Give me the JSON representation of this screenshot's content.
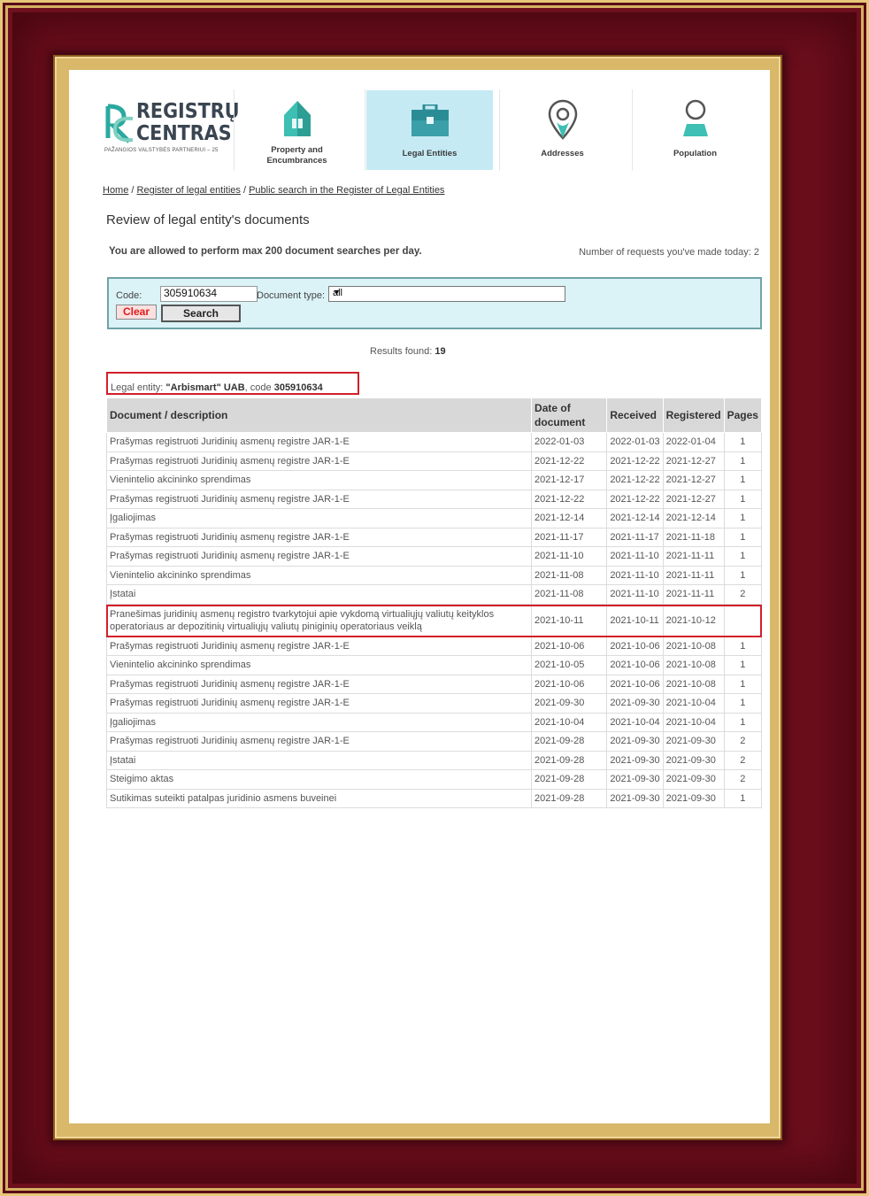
{
  "logo": {
    "line1": "REGISTRŲ",
    "line2": "CENTRAS",
    "tagline": "PAŽANGIOS VALSTYBĖS PARTNERIUI – 25"
  },
  "nav": [
    {
      "label_l1": "Property and",
      "label_l2": "Encumbrances",
      "icon": "house-icon",
      "active": false
    },
    {
      "label_l1": "Legal Entities",
      "label_l2": "",
      "icon": "briefcase-icon",
      "active": true
    },
    {
      "label_l1": "Addresses",
      "label_l2": "",
      "icon": "map-pin-icon",
      "active": false
    },
    {
      "label_l1": "Population",
      "label_l2": "",
      "icon": "person-icon",
      "active": false
    }
  ],
  "breadcrumb": {
    "home": "Home",
    "sep1": " / ",
    "register": "Register of legal entities",
    "sep2": " / ",
    "search": "Public search in the Register of Legal Entities"
  },
  "page_title": "Review of legal entity's documents",
  "limit_text": "You are allowed to perform max 200 document searches per day.",
  "requests_text": "Number of requests you've made today: 2",
  "search": {
    "code_label": "Code:",
    "code_value": "305910634",
    "doctype_label": "Document type:",
    "doctype_value": "all",
    "clear": "Clear",
    "search": "Search"
  },
  "results": {
    "label": "Results found:",
    "count": "19"
  },
  "entity": {
    "label": "Legal entity:",
    "name": "\"Arbismart\" UAB",
    "code_label": ", code",
    "code": "305910634"
  },
  "colors": {
    "accent": "#c6eaf4",
    "highlight": "#d21f2a",
    "frame": "#6e0f1e"
  },
  "table": {
    "headers": {
      "doc": "Document / description",
      "date": "Date of document",
      "received": "Received",
      "registered": "Registered",
      "pages": "Pages"
    },
    "rows": [
      {
        "doc": "Prašymas registruoti Juridinių asmenų registre JAR-1-E",
        "date": "2022-01-03",
        "received": "2022-01-03",
        "registered": "2022-01-04",
        "pages": "1"
      },
      {
        "doc": "Prašymas registruoti Juridinių asmenų registre JAR-1-E",
        "date": "2021-12-22",
        "received": "2021-12-22",
        "registered": "2021-12-27",
        "pages": "1"
      },
      {
        "doc": "Vienintelio akcininko sprendimas",
        "date": "2021-12-17",
        "received": "2021-12-22",
        "registered": "2021-12-27",
        "pages": "1"
      },
      {
        "doc": "Prašymas registruoti Juridinių asmenų registre JAR-1-E",
        "date": "2021-12-22",
        "received": "2021-12-22",
        "registered": "2021-12-27",
        "pages": "1"
      },
      {
        "doc": "Įgaliojimas",
        "date": "2021-12-14",
        "received": "2021-12-14",
        "registered": "2021-12-14",
        "pages": "1"
      },
      {
        "doc": "Prašymas registruoti Juridinių asmenų registre JAR-1-E",
        "date": "2021-11-17",
        "received": "2021-11-17",
        "registered": "2021-11-18",
        "pages": "1"
      },
      {
        "doc": "Prašymas registruoti Juridinių asmenų registre JAR-1-E",
        "date": "2021-11-10",
        "received": "2021-11-10",
        "registered": "2021-11-11",
        "pages": "1"
      },
      {
        "doc": "Vienintelio akcininko sprendimas",
        "date": "2021-11-08",
        "received": "2021-11-10",
        "registered": "2021-11-11",
        "pages": "1"
      },
      {
        "doc": "Įstatai",
        "date": "2021-11-08",
        "received": "2021-11-10",
        "registered": "2021-11-11",
        "pages": "2"
      },
      {
        "doc": "Pranešimas juridinių asmenų registro tvarkytojui apie vykdomą virtualiųjų valiutų keityklos operatoriaus ar depozitinių virtualiųjų valiutų piniginių operatoriaus veiklą",
        "date": "2021-10-11",
        "received": "2021-10-11",
        "registered": "2021-10-12",
        "pages": ""
      },
      {
        "doc": "Prašymas registruoti Juridinių asmenų registre JAR-1-E",
        "date": "2021-10-06",
        "received": "2021-10-06",
        "registered": "2021-10-08",
        "pages": "1"
      },
      {
        "doc": "Vienintelio akcininko sprendimas",
        "date": "2021-10-05",
        "received": "2021-10-06",
        "registered": "2021-10-08",
        "pages": "1"
      },
      {
        "doc": "Prašymas registruoti Juridinių asmenų registre JAR-1-E",
        "date": "2021-10-06",
        "received": "2021-10-06",
        "registered": "2021-10-08",
        "pages": "1"
      },
      {
        "doc": "Prašymas registruoti Juridinių asmenų registre JAR-1-E",
        "date": "2021-09-30",
        "received": "2021-09-30",
        "registered": "2021-10-04",
        "pages": "1"
      },
      {
        "doc": "Įgaliojimas",
        "date": "2021-10-04",
        "received": "2021-10-04",
        "registered": "2021-10-04",
        "pages": "1"
      },
      {
        "doc": "Prašymas registruoti Juridinių asmenų registre JAR-1-E",
        "date": "2021-09-28",
        "received": "2021-09-30",
        "registered": "2021-09-30",
        "pages": "2"
      },
      {
        "doc": "Įstatai",
        "date": "2021-09-28",
        "received": "2021-09-30",
        "registered": "2021-09-30",
        "pages": "2"
      },
      {
        "doc": "Steigimo aktas",
        "date": "2021-09-28",
        "received": "2021-09-30",
        "registered": "2021-09-30",
        "pages": "2"
      },
      {
        "doc": "Sutikimas suteikti patalpas juridinio asmens buveinei",
        "date": "2021-09-28",
        "received": "2021-09-30",
        "registered": "2021-09-30",
        "pages": "1"
      }
    ]
  }
}
